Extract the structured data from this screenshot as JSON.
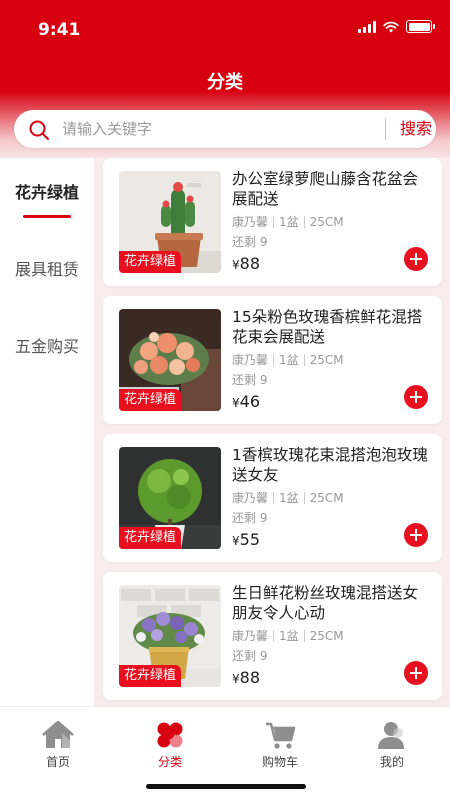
{
  "status": {
    "time": "9:41"
  },
  "header": {
    "title": "分类"
  },
  "search": {
    "placeholder": "请输入关键字",
    "button_label": "搜索"
  },
  "sidebar": {
    "items": [
      {
        "label": "花卉绿植",
        "active": true
      },
      {
        "label": "展具租赁",
        "active": false
      },
      {
        "label": "五金购买",
        "active": false
      }
    ]
  },
  "products": [
    {
      "title": "办公室绿萝爬山藤含花盆会展配送",
      "tag": "花卉绿植",
      "brand": "康乃馨",
      "qty": "1盆",
      "size": "25CM",
      "stock": "还剩 9",
      "currency": "¥",
      "price": "88",
      "image_icon": "cactus-pot"
    },
    {
      "title": "15朵粉色玫瑰香槟鲜花混搭花束会展配送",
      "tag": "花卉绿植",
      "brand": "康乃馨",
      "qty": "1盆",
      "size": "25CM",
      "stock": "还剩 9",
      "currency": "¥",
      "price": "46",
      "image_icon": "rose-bouquet"
    },
    {
      "title": "1香槟玫瑰花束混搭泡泡玫瑰送女友",
      "tag": "花卉绿植",
      "brand": "康乃馨",
      "qty": "1盆",
      "size": "25CM",
      "stock": "还剩 9",
      "currency": "¥",
      "price": "55",
      "image_icon": "topiary-ball"
    },
    {
      "title": "生日鲜花粉丝玫瑰混搭送女朋友令人心动",
      "tag": "花卉绿植",
      "brand": "康乃馨",
      "qty": "1盆",
      "size": "25CM",
      "stock": "还剩 9",
      "currency": "¥",
      "price": "88",
      "image_icon": "purple-flower-pot"
    }
  ],
  "tabbar": {
    "items": [
      {
        "label": "首页",
        "icon": "home-icon",
        "active": false
      },
      {
        "label": "分类",
        "icon": "category-icon",
        "active": true
      },
      {
        "label": "购物车",
        "icon": "cart-icon",
        "active": false
      },
      {
        "label": "我的",
        "icon": "profile-icon",
        "active": false
      }
    ]
  },
  "colors": {
    "brand": "#d7000f",
    "accent": "#e8101e",
    "list_bg": "#f8ecec"
  }
}
